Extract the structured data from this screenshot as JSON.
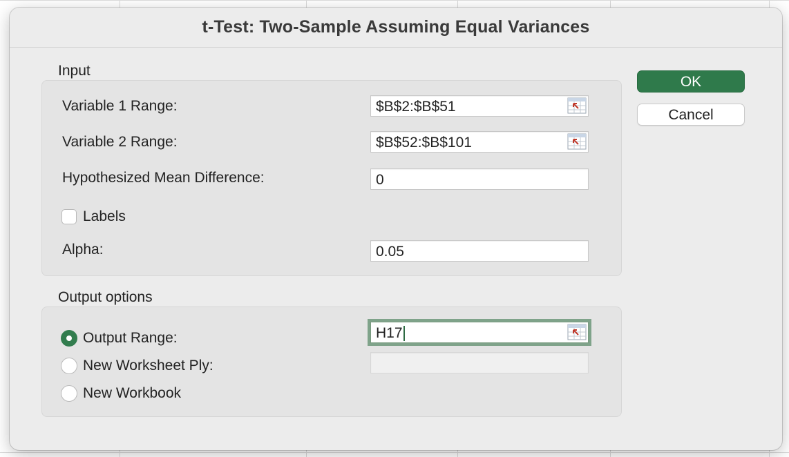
{
  "dialog": {
    "title": "t-Test: Two-Sample Assuming Equal Variances"
  },
  "input_section": {
    "label": "Input",
    "variable1": {
      "label": "Variable 1 Range:",
      "value": "$B$2:$B$51"
    },
    "variable2": {
      "label": "Variable 2 Range:",
      "value": "$B$52:$B$101"
    },
    "hypothesized": {
      "label": "Hypothesized Mean Difference:",
      "value": "0"
    },
    "labels_checkbox": {
      "label": "Labels",
      "checked": false
    },
    "alpha": {
      "label": "Alpha:",
      "value": "0.05"
    }
  },
  "output_section": {
    "label": "Output options",
    "output_range": {
      "label": "Output Range:",
      "value": "H17",
      "selected": true
    },
    "new_worksheet": {
      "label": "New Worksheet Ply:",
      "value": "",
      "selected": false
    },
    "new_workbook": {
      "label": "New Workbook",
      "selected": false
    }
  },
  "buttons": {
    "ok": "OK",
    "cancel": "Cancel"
  },
  "colors": {
    "accent": "#2f7a4b",
    "focus_ring": "#7fa38a"
  },
  "icons": {
    "range_picker": "range-picker-icon"
  }
}
